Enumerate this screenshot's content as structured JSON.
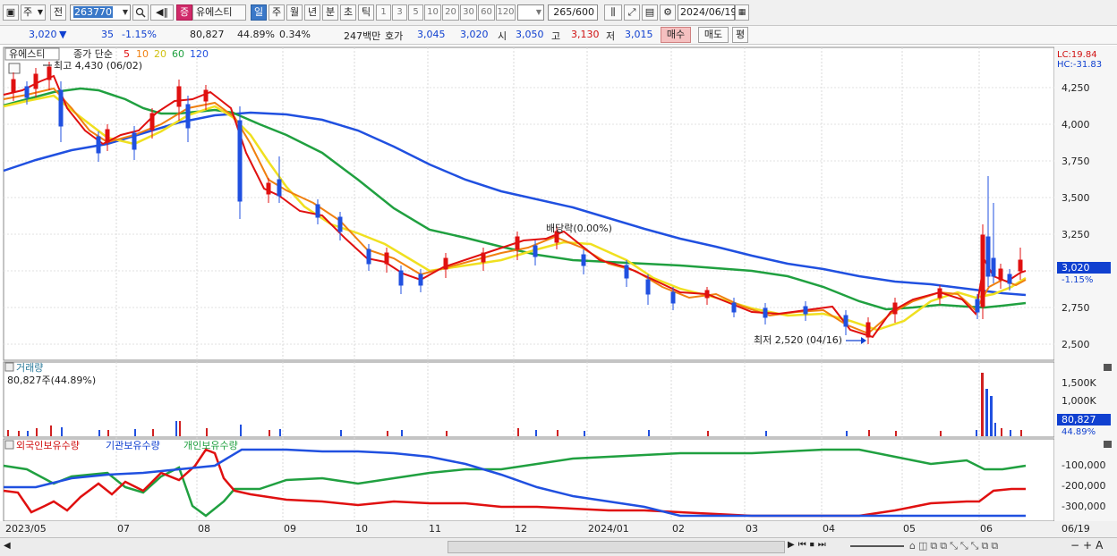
{
  "toolbar": {
    "period_select": "주",
    "ticker_mode": "전",
    "code": "263770",
    "badge": "증",
    "stock_name": "유에스티",
    "periods": [
      "일",
      "주",
      "월",
      "년",
      "분",
      "초",
      "틱"
    ],
    "active_period": "일",
    "intervals": [
      "1",
      "3",
      "5",
      "10",
      "20",
      "30",
      "60",
      "120"
    ],
    "count_display": "265",
    "count_total": "/600",
    "date": "2024/06/19"
  },
  "quote": {
    "price": "3,020",
    "direction": "▼",
    "change": "35",
    "change_pct": "-1.15%",
    "volume": "80,827",
    "volume_ratio": "44.89%",
    "turnover_pct": "0.34%",
    "trade_value": "247백만",
    "bid_label": "호가",
    "ask": "3,045",
    "bid": "3,020",
    "open_label": "시",
    "open": "3,050",
    "high_label": "고",
    "high": "3,130",
    "low_label": "저",
    "low": "3,015",
    "buy_button": "매수",
    "sell_button": "매도",
    "eval_button": "평"
  },
  "price_panel": {
    "stock_label": "유에스티",
    "ma_label": "종가 단순",
    "ma_periods": [
      "5",
      "10",
      "20",
      "60",
      "120"
    ],
    "ma_colors": [
      "#e01010",
      "#f08010",
      "#f0e020",
      "#20a040",
      "#2050e0"
    ],
    "high_annotation": "최고 4,430 (06/02)",
    "low_annotation": "최저 2,520 (04/16)",
    "dividend_annotation": "배당락(0.00%)",
    "lc_label": "LC:19.84",
    "hc_label": "HC:-31.83",
    "y_ticks": [
      "4,250",
      "4,000",
      "3,750",
      "3,500",
      "3,250",
      "3,000",
      "2,750",
      "2,500"
    ],
    "current_price_tag": "3,020",
    "current_pct_tag": "-1.15%"
  },
  "volume_panel": {
    "title": "거래량",
    "value_label": "80,827주(44.89%)",
    "y_ticks": [
      "1,500K",
      "1,000K",
      "500K"
    ],
    "current_tag": "80,827",
    "current_pct": "44.89%"
  },
  "holdings_panel": {
    "series": [
      "외국인보유수량",
      "기관보유수량",
      "개인보유수량"
    ],
    "series_colors": [
      "#e01010",
      "#2050e0",
      "#20a040"
    ],
    "y_ticks": [
      "-100,000",
      "-200,000",
      "-300,000"
    ]
  },
  "x_axis": {
    "labels": [
      "2023/05",
      "07",
      "08",
      "09",
      "10",
      "11",
      "12",
      "2024/01",
      "02",
      "03",
      "04",
      "05",
      "06"
    ],
    "end_label": "06/19"
  },
  "chart_data": {
    "type": "line",
    "title": "",
    "x": [
      "2023/05",
      "07",
      "08",
      "09",
      "10",
      "11",
      "12",
      "2024/01",
      "02",
      "03",
      "04",
      "05",
      "06",
      "06/19"
    ],
    "series": [
      {
        "name": "5",
        "values": [
          4250,
          4150,
          4200,
          3550,
          3300,
          2950,
          3150,
          3050,
          2850,
          2680,
          2560,
          2850,
          3250,
          3020
        ]
      },
      {
        "name": "20",
        "values": [
          4200,
          4050,
          4150,
          3800,
          3400,
          3000,
          3100,
          3100,
          2900,
          2800,
          2700,
          2800,
          2950,
          2950
        ]
      },
      {
        "name": "60",
        "values": [
          4220,
          4200,
          4100,
          3950,
          3700,
          3300,
          3150,
          3050,
          2990,
          2900,
          2820,
          2780,
          2760,
          2800
        ]
      },
      {
        "name": "120",
        "values": [
          3650,
          3850,
          4000,
          4060,
          3950,
          3700,
          3450,
          3200,
          3050,
          2970,
          2900,
          2880,
          2870,
          2850
        ]
      }
    ],
    "ylim": [
      2400,
      4500
    ]
  }
}
